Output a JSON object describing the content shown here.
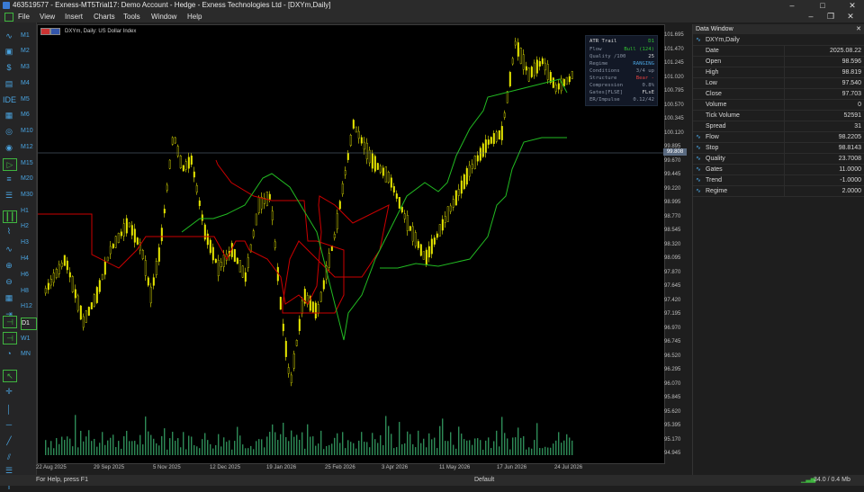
{
  "window": {
    "title": "463519577 - Exness-MT5Trial17: Demo Account - Hedge - Exness Technologies Ltd - [DXYm,Daily]"
  },
  "menu": [
    "File",
    "View",
    "Insert",
    "Charts",
    "Tools",
    "Window",
    "Help"
  ],
  "timeframes": [
    "M1",
    "M2",
    "M3",
    "M4",
    "M5",
    "M6",
    "M10",
    "M12",
    "M15",
    "M20",
    "M30",
    "H1",
    "H2",
    "H3",
    "H4",
    "H6",
    "H8",
    "H12",
    "D1",
    "W1",
    "MN"
  ],
  "active_timeframe": "D1",
  "chart": {
    "title": "DXYm, Daily:  US Dollar Index",
    "current_price": "99.808",
    "y_ticks": [
      "101.695",
      "101.470",
      "101.245",
      "101.020",
      "100.795",
      "100.570",
      "100.345",
      "100.120",
      "99.895",
      "99.670",
      "99.445",
      "99.220",
      "98.995",
      "98.770",
      "98.545",
      "98.320",
      "98.095",
      "97.870",
      "97.645",
      "97.420",
      "97.195",
      "96.970",
      "96.745",
      "96.520",
      "96.295",
      "96.070",
      "95.845",
      "95.620",
      "95.395",
      "95.170",
      "94.945"
    ],
    "x_ticks": [
      "22 Aug 2025",
      "29 Sep 2025",
      "5 Nov 2025",
      "12 Dec 2025",
      "19 Jan 2026",
      "25 Feb 2026",
      "3 Apr 2026",
      "11 May 2026",
      "17 Jun 2026",
      "24 Jul 2026"
    ],
    "colors": {
      "candles": "#e6e600",
      "trail_red": "#cc0000",
      "trail_green": "#22bb22",
      "volume": "#2e8b57",
      "background": "#000000"
    }
  },
  "atr_panel": {
    "title": "ATR Trail",
    "timeframe": "D1",
    "rows": [
      {
        "k": "Flow",
        "v": "Bull (124)",
        "color": "#31c131"
      },
      {
        "k": "Quality /100",
        "v": "25",
        "color": "#d8d8d8"
      },
      {
        "k": "Regime",
        "v": "RANGING",
        "color": "#4aa3df"
      },
      {
        "k": "Conditions",
        "v": "3/4 up",
        "color": "#8a94a4"
      },
      {
        "k": "Structure",
        "v": "Bear -",
        "color": "#e04040"
      },
      {
        "k": "Compression",
        "v": "0.8%",
        "color": "#8a94a4"
      },
      {
        "k": "Gates[FLSE]",
        "v": "FLsE",
        "color": "#d8d8d8"
      },
      {
        "k": "ER/Impulse",
        "v": "0.12/42",
        "color": "#8a94a4"
      }
    ]
  },
  "data_window": {
    "title": "Data Window",
    "symbol": "DXYm,Daily",
    "rows": [
      {
        "k": "Date",
        "v": "2025.08.22",
        "icon": ""
      },
      {
        "k": "Open",
        "v": "98.596",
        "icon": ""
      },
      {
        "k": "High",
        "v": "98.819",
        "icon": ""
      },
      {
        "k": "Low",
        "v": "97.540",
        "icon": ""
      },
      {
        "k": "Close",
        "v": "97.703",
        "icon": ""
      },
      {
        "k": "Volume",
        "v": "0",
        "icon": ""
      },
      {
        "k": "Tick Volume",
        "v": "52591",
        "icon": ""
      },
      {
        "k": "Spread",
        "v": "31",
        "icon": ""
      },
      {
        "k": "Flow",
        "v": "98.2205",
        "icon": "indicator-icon"
      },
      {
        "k": "Stop",
        "v": "98.8143",
        "icon": "indicator-icon"
      },
      {
        "k": "Quality",
        "v": "23.7008",
        "icon": "indicator-icon"
      },
      {
        "k": "Gates",
        "v": "11.0000",
        "icon": "indicator-icon"
      },
      {
        "k": "Trend",
        "v": "-1.0000",
        "icon": "indicator-icon"
      },
      {
        "k": "Regime",
        "v": "2.0000",
        "icon": "indicator-icon"
      }
    ]
  },
  "status": {
    "help": "For Help, press F1",
    "profile": "Default",
    "traffic": "34.0 / 0.4 Mb"
  }
}
